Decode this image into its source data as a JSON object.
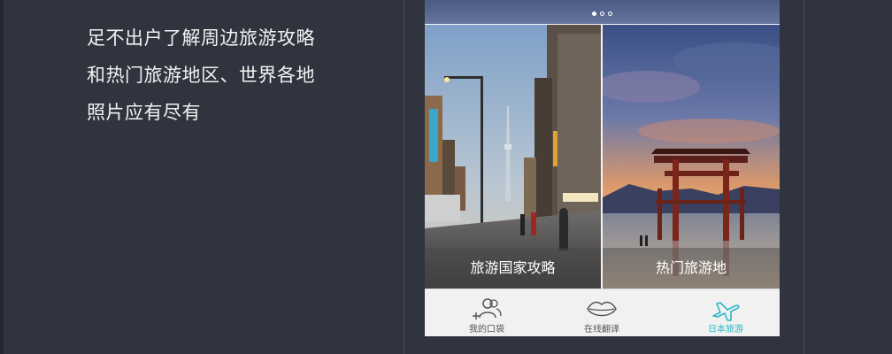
{
  "promo": {
    "lines": [
      "足不出户了解周边旅游攻略",
      "和热门旅游地区、世界各地",
      "照片应有尽有"
    ]
  },
  "app": {
    "carousel": {
      "page_count": 3,
      "active_index": 0
    },
    "tiles": [
      {
        "caption": "旅游国家攻略",
        "image": "tokyo-street-photo"
      },
      {
        "caption": "热门旅游地",
        "image": "torii-gate-sunset-photo"
      }
    ],
    "tabs": [
      {
        "label": "我的口袋",
        "icon": "people-add-icon",
        "active": false
      },
      {
        "label": "在线翻译",
        "icon": "lips-icon",
        "active": false
      },
      {
        "label": "日本旅游",
        "icon": "airplane-icon",
        "active": true
      }
    ],
    "colors": {
      "accent": "#2bb8c4",
      "background": "#2f343e"
    }
  }
}
